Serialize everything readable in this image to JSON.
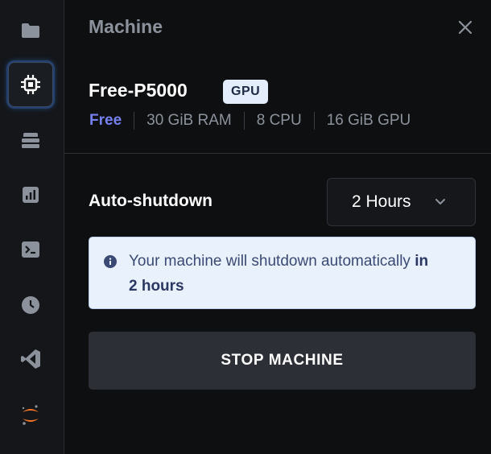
{
  "sidebar": {
    "items": [
      {
        "icon": "folder-icon"
      },
      {
        "icon": "cpu-icon",
        "active": true
      },
      {
        "icon": "stack-icon"
      },
      {
        "icon": "bar-chart-icon"
      },
      {
        "icon": "terminal-icon"
      },
      {
        "icon": "clock-icon"
      },
      {
        "icon": "vscode-icon"
      },
      {
        "icon": "jupyter-icon"
      }
    ]
  },
  "panel": {
    "title": "Machine",
    "close_icon": "close-icon"
  },
  "machine": {
    "name": "Free-P5000",
    "badge": "GPU",
    "specs": {
      "tier": "Free",
      "ram": "30 GiB RAM",
      "cpu": "8 CPU",
      "gpu": "16 GiB GPU"
    }
  },
  "auto_shutdown": {
    "label": "Auto-shutdown",
    "selected": "2 Hours"
  },
  "info": {
    "icon": "info-icon",
    "text_prefix": "Your machine will shutdown automatically ",
    "text_bold": "in 2 hours"
  },
  "stop_button": {
    "label": "STOP MACHINE"
  },
  "colors": {
    "background": "#0e0f11",
    "accent_free": "#7681f0",
    "info_bg": "#e9f1fd",
    "button_bg": "#2d2f36",
    "jupyter_orange": "#f37726"
  }
}
